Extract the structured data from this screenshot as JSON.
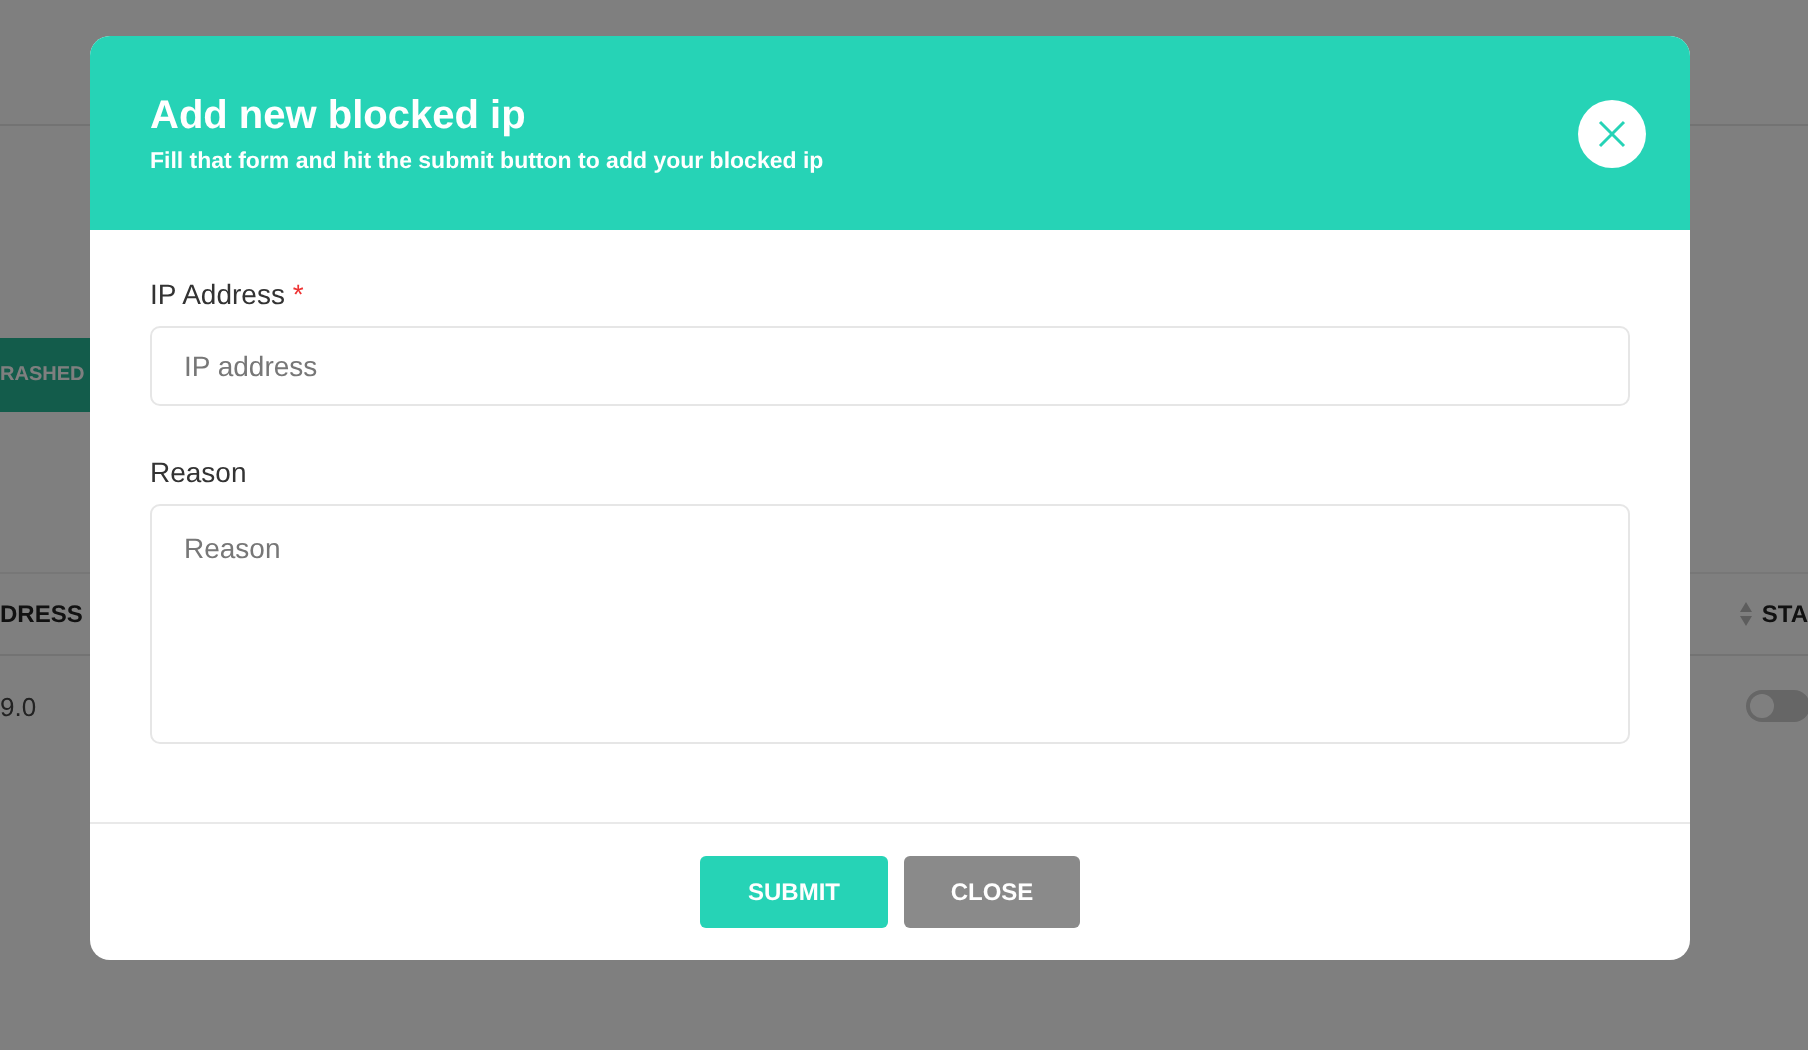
{
  "background": {
    "tag": "RASHED",
    "table": {
      "columns": [
        "DRESS",
        "STA"
      ],
      "rows": [
        {
          "column_1": "9.0",
          "enabled": false
        }
      ]
    }
  },
  "modal": {
    "title": "Add new blocked ip",
    "subtitle": "Fill that form and hit the submit button to add your blocked ip",
    "fields": [
      {
        "kind": "input",
        "label": "IP Address",
        "required_mark": "*",
        "placeholder": "IP address"
      },
      {
        "kind": "textarea",
        "label": "Reason",
        "placeholder": "Reason"
      }
    ],
    "buttons": [
      {
        "kind": "primary",
        "label": "SUBMIT"
      },
      {
        "kind": "secondary",
        "label": "CLOSE"
      }
    ]
  }
}
